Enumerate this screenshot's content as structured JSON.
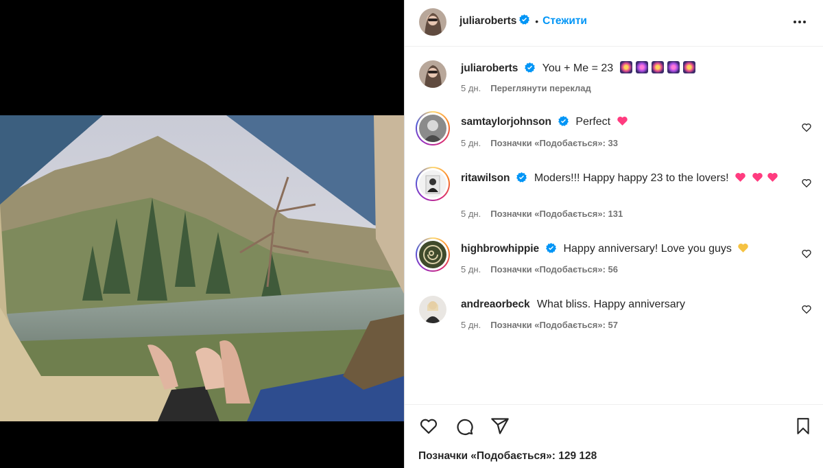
{
  "post": {
    "author": "juliaroberts",
    "follow_label": "Стежити",
    "separator": "•",
    "caption_text": "You + Me = 23",
    "caption_time": "5 дн.",
    "translate_label": "Переглянути переклад",
    "likes_total": "Позначки «Подобається»: 129 128"
  },
  "comments": [
    {
      "user": "samtaylorjohnson",
      "verified": true,
      "text": "Perfect",
      "time": "5 дн.",
      "likes": "Позначки «Подобається»: 33"
    },
    {
      "user": "ritawilson",
      "verified": true,
      "text": "Moders!!! Happy happy 23 to the lovers!",
      "time": "5 дн.",
      "likes": "Позначки «Подобається»: 131"
    },
    {
      "user": "highbrowhippie",
      "verified": true,
      "text": "Happy anniversary! Love you guys",
      "time": "5 дн.",
      "likes": "Позначки «Подобається»: 56"
    },
    {
      "user": "andreaorbeck",
      "verified": false,
      "text": "What bliss. Happy anniversary",
      "time": "5 дн.",
      "likes": "Позначки «Подобається»: 57"
    }
  ],
  "icons": {
    "verified": "verified-badge-icon",
    "more": "more-options-icon",
    "like": "heart-icon",
    "comment": "comment-icon",
    "share": "share-icon",
    "save": "bookmark-icon"
  },
  "colors": {
    "accent": "#0095f6",
    "verified": "#0095f6",
    "heart_pink": "#ff3b7f",
    "heart_yellow": "#f5c242",
    "meta_gray": "#737373"
  }
}
